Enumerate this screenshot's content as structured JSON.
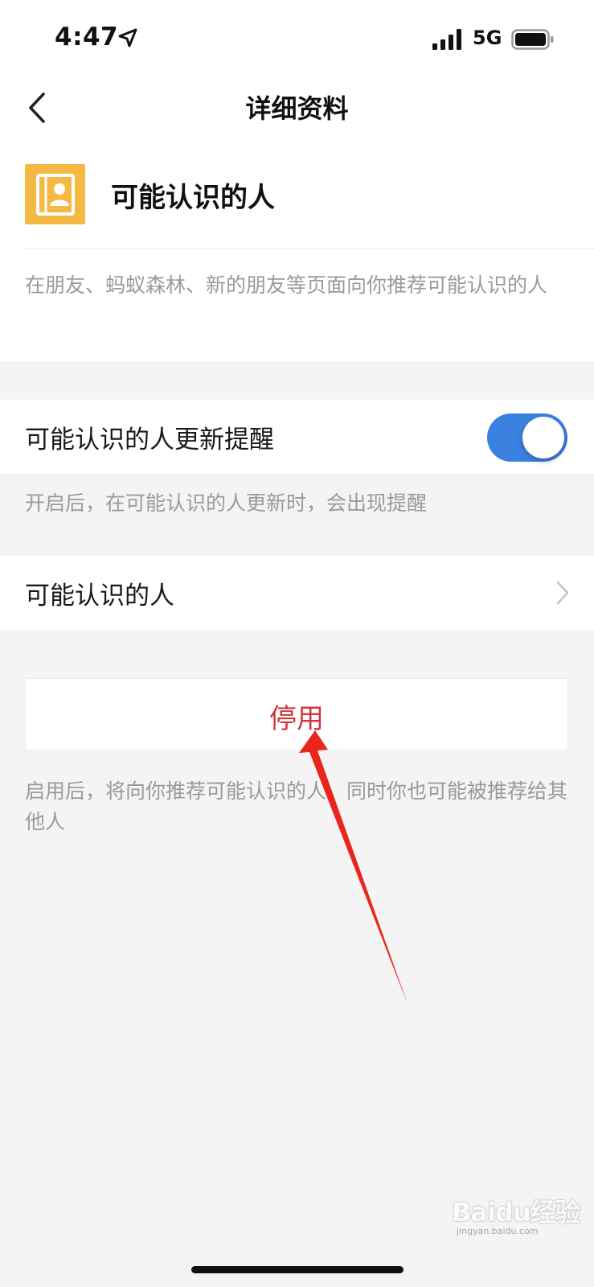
{
  "status_bar": {
    "time": "4:47",
    "network": "5G",
    "icons": [
      "location-arrow-icon",
      "signal-bars-icon",
      "battery-icon"
    ]
  },
  "nav": {
    "title": "详细资料",
    "back_icon": "chevron-left-icon"
  },
  "profile": {
    "name": "可能认识的人",
    "icon": "contacts-book-icon",
    "icon_color": "#f4b942",
    "description": "在朋友、蚂蚁森林、新的朋友等页面向你推荐可能认识的人"
  },
  "update_reminder": {
    "label": "可能认识的人更新提醒",
    "enabled": true,
    "toggle_color": "#3b82e0",
    "hint": "开启后，在可能认识的人更新时，会出现提醒"
  },
  "people_link": {
    "label": "可能认识的人",
    "icon": "chevron-right-icon"
  },
  "disable_action": {
    "label": "停用",
    "label_color": "#d0373d",
    "hint": "启用后，将向你推荐可能认识的人，同时你也可能被推荐给其他人"
  },
  "watermark": {
    "text": "Baidu经验",
    "subtext": "jingyan.baidu.com"
  },
  "annotation": {
    "type": "red-arrow",
    "color": "#e8261c",
    "points_to": "disable-button"
  }
}
